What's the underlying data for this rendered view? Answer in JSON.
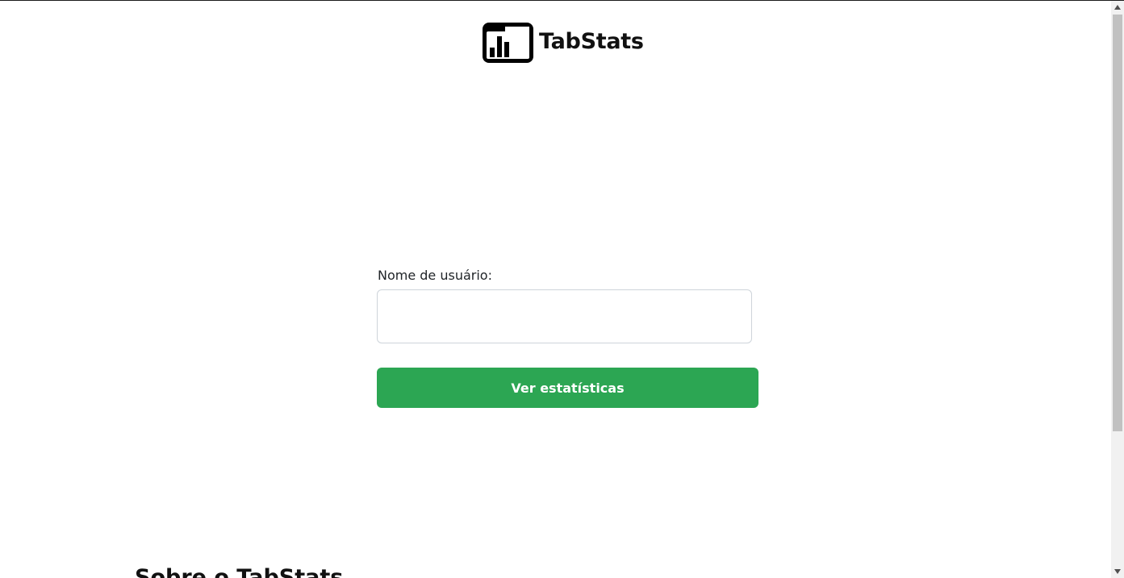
{
  "brand": {
    "name": "TabStats",
    "logo_icon": "bar-chart-window-icon"
  },
  "form": {
    "username_label": "Nome de usuário:",
    "username_value": "",
    "username_placeholder": "",
    "submit_label": "Ver estatísticas"
  },
  "section": {
    "heading": "Sobre o TabStats"
  },
  "colors": {
    "button_bg": "#2ca653",
    "button_text": "#ffffff",
    "input_border": "#ced4da"
  }
}
